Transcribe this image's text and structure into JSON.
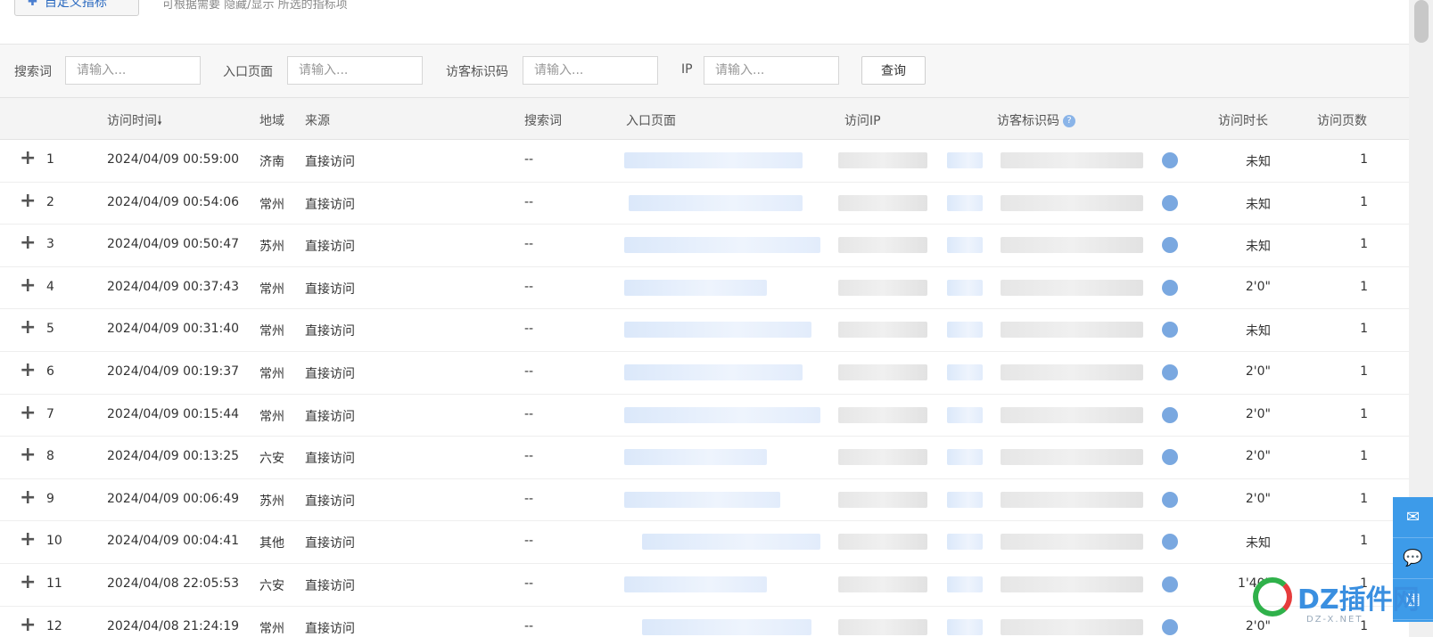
{
  "topbar": {
    "custom_button": "自定义指标",
    "hint": "可根据需要 隐藏/显示 所选的指标项"
  },
  "filters": {
    "search_label": "搜索词",
    "entry_label": "入口页面",
    "visitor_label": "访客标识码",
    "ip_label": "IP",
    "placeholder": "请输入...",
    "query_button": "查询"
  },
  "table": {
    "headers": {
      "visit_time": "访问时间",
      "region": "地域",
      "source": "来源",
      "search_term": "搜索词",
      "entry_page": "入口页面",
      "visit_ip": "访问IP",
      "visitor_id": "访客标识码",
      "duration": "访问时长",
      "pages": "访问页数"
    },
    "rows": [
      {
        "n": "1",
        "time": "2024/04/09 00:59:00",
        "region": "济南",
        "source": "直接访问",
        "search": "--",
        "duration": "未知",
        "pages": "1"
      },
      {
        "n": "2",
        "time": "2024/04/09 00:54:06",
        "region": "常州",
        "source": "直接访问",
        "search": "--",
        "duration": "未知",
        "pages": "1"
      },
      {
        "n": "3",
        "time": "2024/04/09 00:50:47",
        "region": "苏州",
        "source": "直接访问",
        "search": "--",
        "duration": "未知",
        "pages": "1"
      },
      {
        "n": "4",
        "time": "2024/04/09 00:37:43",
        "region": "常州",
        "source": "直接访问",
        "search": "--",
        "duration": "2'0\"",
        "pages": "1"
      },
      {
        "n": "5",
        "time": "2024/04/09 00:31:40",
        "region": "常州",
        "source": "直接访问",
        "search": "--",
        "duration": "未知",
        "pages": "1"
      },
      {
        "n": "6",
        "time": "2024/04/09 00:19:37",
        "region": "常州",
        "source": "直接访问",
        "search": "--",
        "duration": "2'0\"",
        "pages": "1"
      },
      {
        "n": "7",
        "time": "2024/04/09 00:15:44",
        "region": "常州",
        "source": "直接访问",
        "search": "--",
        "duration": "2'0\"",
        "pages": "1"
      },
      {
        "n": "8",
        "time": "2024/04/09 00:13:25",
        "region": "六安",
        "source": "直接访问",
        "search": "--",
        "duration": "2'0\"",
        "pages": "1"
      },
      {
        "n": "9",
        "time": "2024/04/09 00:06:49",
        "region": "苏州",
        "source": "直接访问",
        "search": "--",
        "duration": "2'0\"",
        "pages": "1"
      },
      {
        "n": "10",
        "time": "2024/04/09 00:04:41",
        "region": "其他",
        "source": "直接访问",
        "search": "--",
        "duration": "未知",
        "pages": "1"
      },
      {
        "n": "11",
        "time": "2024/04/08 22:05:53",
        "region": "六安",
        "source": "直接访问",
        "search": "--",
        "duration": "1'40\"",
        "pages": "1"
      },
      {
        "n": "12",
        "time": "2024/04/08 21:24:19",
        "region": "常州",
        "source": "直接访问",
        "search": "--",
        "duration": "2'0\"",
        "pages": "1"
      }
    ]
  },
  "watermark": {
    "text": "DZ插件网",
    "sub": "DZ-X.NET"
  },
  "icons": {
    "sort": "arrow-down-icon",
    "help": "question-icon",
    "expand": "plus-icon",
    "trend": "trend-icon",
    "mail": "mail-icon",
    "wechat": "wechat-icon"
  },
  "colors": {
    "accent": "#3d9be9",
    "help_icon": "#8ab4e8"
  }
}
